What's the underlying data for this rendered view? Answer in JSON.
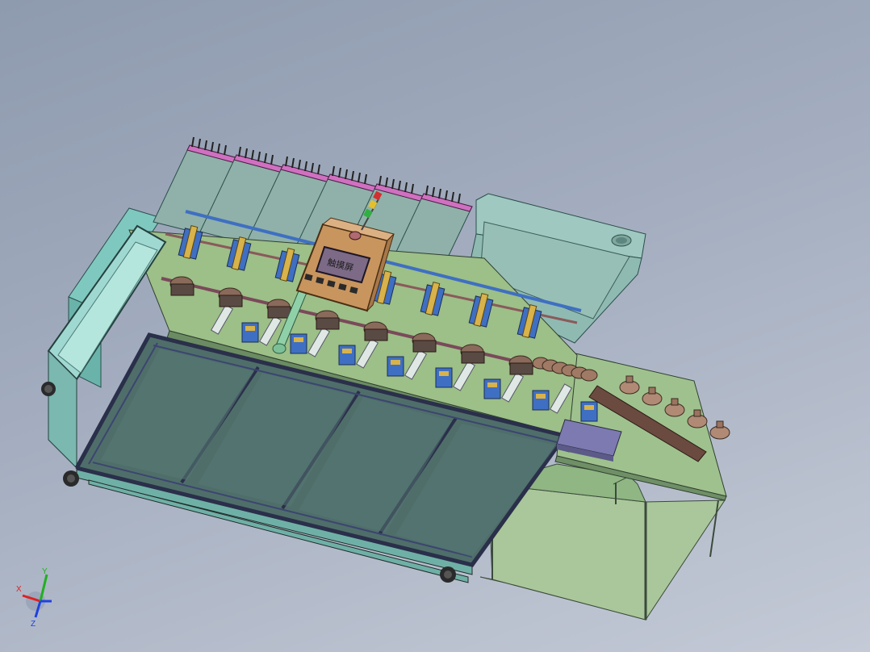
{
  "colors": {
    "background_top": "#8e9aae",
    "background_bottom": "#c4cad6",
    "frame": "#5b8f8f",
    "table_top": "#9bbf86",
    "glass": "#4f6e6a",
    "cabinet": "#86a99e",
    "control_box": "#c8955e",
    "hmi_screen": "#7c6a86",
    "rail_blue": "#3f6fc2",
    "accent_yellow": "#d8b24a",
    "bottle_brown": "#8a6a5a",
    "axis_x": "#e02020",
    "axis_y": "#20b020",
    "axis_z": "#2040e0"
  },
  "model": {
    "hmi_label": "触摸屏",
    "station_count": 6
  },
  "triad": {
    "x_label": "X",
    "y_label": "Y",
    "z_label": "Z"
  }
}
